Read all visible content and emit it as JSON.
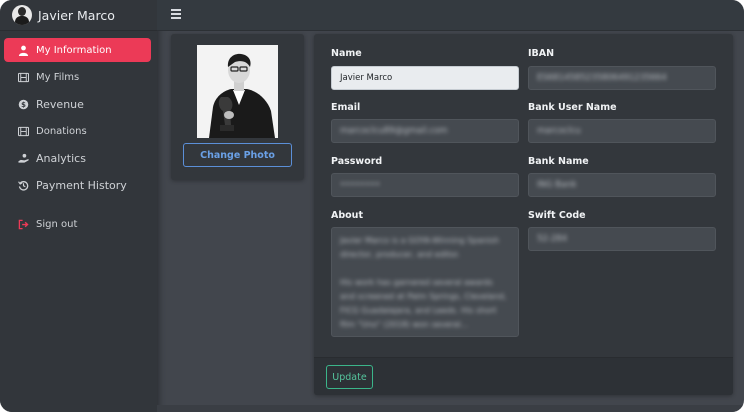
{
  "user": {
    "name": "Javier Marco"
  },
  "sidebar": {
    "items": [
      {
        "label": "My Information",
        "icon": "user-icon",
        "active": true
      },
      {
        "label": "My Films",
        "icon": "film-icon"
      },
      {
        "label": "Revenue",
        "icon": "money-icon"
      },
      {
        "label": "Donations",
        "icon": "film-icon"
      },
      {
        "label": "Analytics",
        "icon": "hand-holding-icon"
      },
      {
        "label": "Payment History",
        "icon": "history-icon"
      },
      {
        "label": "Sign out",
        "icon": "sign-out-icon"
      }
    ]
  },
  "profile": {
    "change_photo_label": "Change Photo"
  },
  "form": {
    "name_label": "Name",
    "name_value": "Javier Marco",
    "email_label": "Email",
    "email_value": "marcoclcu89@gmail.com",
    "password_label": "Password",
    "password_value": "••••••••",
    "about_label": "About",
    "about_value": "Javier Marco is a GOYA-Winning Spanish director, producer, and editor.\n\nHis work has garnered several awards and screened at Palm Springs, Cleveland, FICG Guadalajara, and Leeds. His short film \"Uno\" (2018) won several...",
    "iban_label": "IBAN",
    "iban_value": "ES6814585235806491235664",
    "bank_user_label": "Bank User Name",
    "bank_user_value": "marcoclcu",
    "bank_name_label": "Bank Name",
    "bank_name_value": "ING Bank",
    "swift_label": "Swift Code",
    "swift_value": "52-284",
    "update_label": "Update"
  },
  "colors": {
    "accent": "#ec3a57",
    "sidebar_bg": "#32363b",
    "content_bg": "#42464d",
    "card_bg": "#33373c",
    "change_photo": "#6aa0e6",
    "update": "#55c59d"
  }
}
